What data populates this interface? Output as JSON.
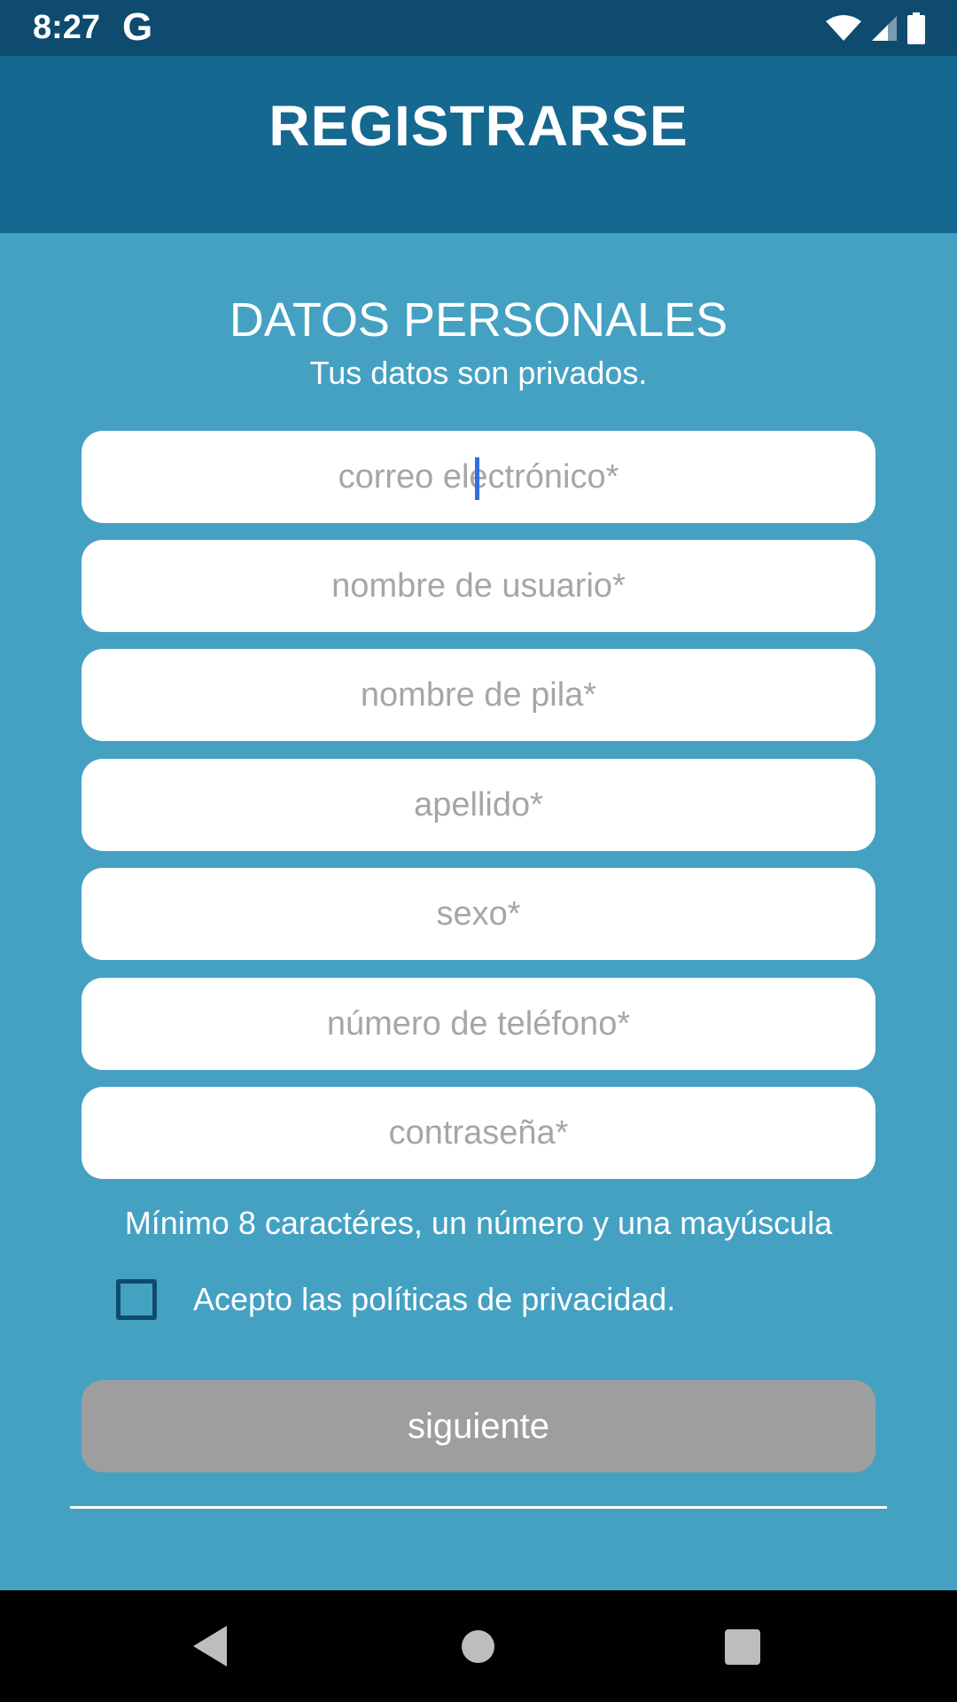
{
  "status_bar": {
    "time": "8:27",
    "app_icon": "google-g-icon"
  },
  "app_bar": {
    "title": "REGISTRARSE"
  },
  "form": {
    "title": "DATOS PERSONALES",
    "subtitle": "Tus datos son privados.",
    "fields": {
      "email": "correo electrónico*",
      "username": "nombre de usuario*",
      "first_name": "nombre de pila*",
      "last_name": "apellido*",
      "sex": "sexo*",
      "phone": "número de teléfono*",
      "password": "contraseña*"
    },
    "password_hint": "Mínimo 8 caractéres, un número y una mayúscula",
    "privacy_checkbox_label": "Acepto las políticas de privacidad.",
    "privacy_checked": false,
    "next_button": "siguiente"
  },
  "colors": {
    "status_bar": "#0e4b6e",
    "app_bar": "#156890",
    "background": "#45a1c2",
    "button_disabled": "#9e9e9e",
    "caret": "#2f6fe0"
  }
}
